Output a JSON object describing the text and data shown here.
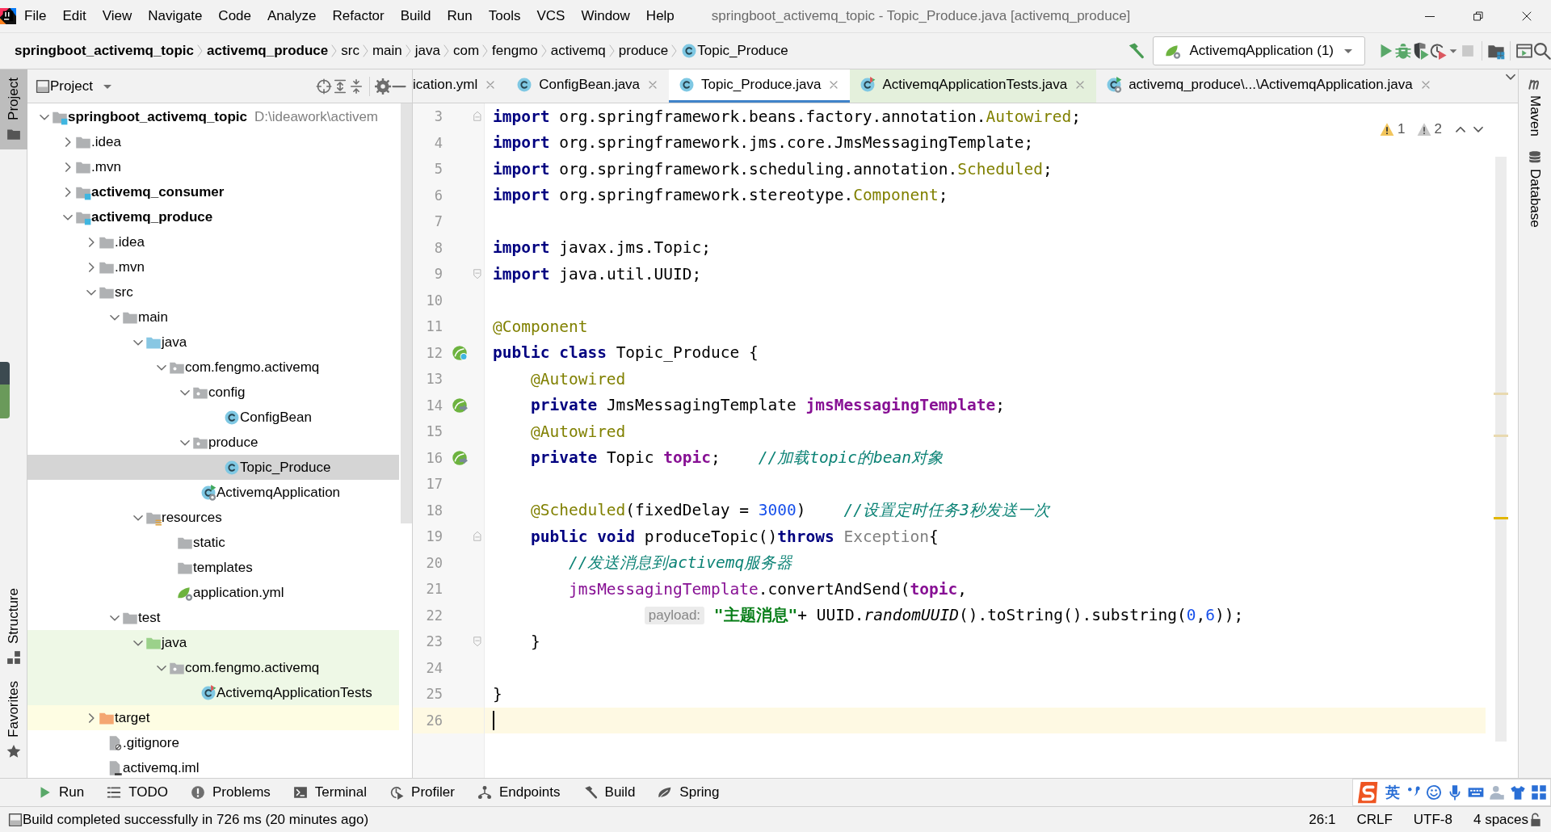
{
  "window": {
    "title": "springboot_activemq_topic - Topic_Produce.java [activemq_produce]"
  },
  "menu": [
    "File",
    "Edit",
    "View",
    "Navigate",
    "Code",
    "Analyze",
    "Refactor",
    "Build",
    "Run",
    "Tools",
    "VCS",
    "Window",
    "Help"
  ],
  "breadcrumbs": [
    {
      "label": "springboot_activemq_topic",
      "kind": "module"
    },
    {
      "label": "activemq_produce",
      "kind": "module"
    },
    {
      "label": "src",
      "kind": "dir"
    },
    {
      "label": "main",
      "kind": "dir"
    },
    {
      "label": "java",
      "kind": "dir"
    },
    {
      "label": "com",
      "kind": "dir"
    },
    {
      "label": "fengmo",
      "kind": "dir"
    },
    {
      "label": "activemq",
      "kind": "dir"
    },
    {
      "label": "produce",
      "kind": "dir"
    },
    {
      "label": "Topic_Produce",
      "kind": "class"
    }
  ],
  "run_config": {
    "label": "ActivemqApplication (1)"
  },
  "left_tool_windows": [
    {
      "label": "Project",
      "selected": true
    },
    {
      "label": "Structure",
      "selected": false
    },
    {
      "label": "Favorites",
      "selected": false
    }
  ],
  "right_tool_windows": [
    {
      "label": "Maven"
    },
    {
      "label": "Database"
    }
  ],
  "project": {
    "title": "Project",
    "tree": [
      {
        "label": "springboot_activemq_topic",
        "path": "D:\\ideawork\\activem",
        "kind": "module",
        "expanded": true,
        "selected": false,
        "children": [
          {
            "label": ".idea",
            "kind": "folder",
            "expanded": false,
            "selected": false
          },
          {
            "label": ".mvn",
            "kind": "folder",
            "expanded": false,
            "selected": false
          },
          {
            "label": "activemq_consumer",
            "kind": "module",
            "expanded": false,
            "selected": false
          },
          {
            "label": "activemq_produce",
            "kind": "module",
            "expanded": true,
            "selected": false,
            "children": [
              {
                "label": ".idea",
                "kind": "folder",
                "expanded": false,
                "selected": false
              },
              {
                "label": ".mvn",
                "kind": "folder",
                "expanded": false,
                "selected": false
              },
              {
                "label": "src",
                "kind": "folder",
                "expanded": true,
                "selected": false,
                "children": [
                  {
                    "label": "main",
                    "kind": "folder",
                    "expanded": true,
                    "selected": false,
                    "children": [
                      {
                        "label": "java",
                        "kind": "source-folder",
                        "expanded": true,
                        "selected": false,
                        "children": [
                          {
                            "label": "com.fengmo.activemq",
                            "kind": "package",
                            "expanded": true,
                            "selected": false,
                            "children": [
                              {
                                "label": "config",
                                "kind": "package",
                                "expanded": true,
                                "selected": false,
                                "children": [
                                  {
                                    "label": "ConfigBean",
                                    "kind": "class",
                                    "selected": false
                                  }
                                ]
                              },
                              {
                                "label": "produce",
                                "kind": "package",
                                "expanded": true,
                                "selected": false,
                                "children": [
                                  {
                                    "label": "Topic_Produce",
                                    "kind": "class",
                                    "selected": true
                                  }
                                ]
                              },
                              {
                                "label": "ActivemqApplication",
                                "kind": "app-class",
                                "selected": false
                              }
                            ]
                          }
                        ]
                      },
                      {
                        "label": "resources",
                        "kind": "resources",
                        "expanded": true,
                        "selected": false,
                        "children": [
                          {
                            "label": "static",
                            "kind": "folder",
                            "selected": false
                          },
                          {
                            "label": "templates",
                            "kind": "folder",
                            "selected": false
                          },
                          {
                            "label": "application.yml",
                            "kind": "yml",
                            "selected": false
                          }
                        ]
                      }
                    ]
                  },
                  {
                    "label": "test",
                    "kind": "folder",
                    "expanded": true,
                    "selected": false,
                    "children": [
                      {
                        "label": "java",
                        "kind": "test-folder",
                        "color": "#eef8e6",
                        "expanded": true,
                        "selected": false,
                        "children": [
                          {
                            "label": "com.fengmo.activemq",
                            "kind": "package",
                            "color": "#eef8e6",
                            "expanded": true,
                            "selected": false,
                            "children": [
                              {
                                "label": "ActivemqApplicationTests",
                                "kind": "test-class",
                                "color": "#eef8e6",
                                "selected": false
                              }
                            ]
                          }
                        ]
                      }
                    ]
                  }
                ]
              },
              {
                "label": "target",
                "kind": "excluded-folder",
                "color": "#fefde3",
                "expanded": false,
                "selected": false
              },
              {
                "label": ".gitignore",
                "kind": "ignore-file",
                "selected": false
              },
              {
                "label": "activemq.iml",
                "kind": "iml-file",
                "selected": false
              }
            ]
          }
        ]
      }
    ]
  },
  "editor_tabs": [
    {
      "label": "ication.yml",
      "kind": "none",
      "selected": false
    },
    {
      "label": "ConfigBean.java",
      "kind": "class",
      "selected": false
    },
    {
      "label": "Topic_Produce.java",
      "kind": "class",
      "selected": true
    },
    {
      "label": "ActivemqApplicationTests.java",
      "kind": "test-class",
      "color": "#e4f0dc",
      "selected": false
    },
    {
      "label": "activemq_produce\\...\\ActivemqApplication.java",
      "kind": "app-class",
      "selected": false
    }
  ],
  "inspections": [
    {
      "kind": "warning",
      "count": "1"
    },
    {
      "kind": "weak-warning",
      "count": "2"
    }
  ],
  "lines": [
    {
      "number": "3",
      "kind": "fold-start",
      "current": false,
      "tokens": [
        {
          "kind": "kw",
          "text": "import"
        },
        {
          "kind": "plain",
          "text": " org.springframework.beans.factory.annotation."
        },
        {
          "kind": "ann",
          "text": "Autowired"
        },
        {
          "kind": "plain",
          "text": ";"
        }
      ]
    },
    {
      "number": "4",
      "kind": "plain",
      "current": false,
      "tokens": [
        {
          "kind": "kw",
          "text": "import"
        },
        {
          "kind": "plain",
          "text": " org.springframework.jms.core.JmsMessagingTemplate;"
        }
      ]
    },
    {
      "number": "5",
      "kind": "plain",
      "current": false,
      "tokens": [
        {
          "kind": "kw",
          "text": "import"
        },
        {
          "kind": "plain",
          "text": " org.springframework.scheduling.annotation."
        },
        {
          "kind": "ann",
          "text": "Scheduled"
        },
        {
          "kind": "plain",
          "text": ";"
        }
      ]
    },
    {
      "number": "6",
      "kind": "plain",
      "current": false,
      "tokens": [
        {
          "kind": "kw",
          "text": "import"
        },
        {
          "kind": "plain",
          "text": " org.springframework.stereotype."
        },
        {
          "kind": "ann",
          "text": "Component"
        },
        {
          "kind": "plain",
          "text": ";"
        }
      ]
    },
    {
      "number": "7",
      "kind": "plain",
      "current": false
    },
    {
      "number": "8",
      "kind": "plain",
      "current": false,
      "tokens": [
        {
          "kind": "kw",
          "text": "import"
        },
        {
          "kind": "plain",
          "text": " javax.jms.Topic;"
        }
      ]
    },
    {
      "number": "9",
      "kind": "fold-end",
      "current": false,
      "tokens": [
        {
          "kind": "kw",
          "text": "import"
        },
        {
          "kind": "plain",
          "text": " java.util.UUID;"
        }
      ]
    },
    {
      "number": "10",
      "kind": "plain",
      "current": false
    },
    {
      "number": "11",
      "kind": "plain",
      "current": false,
      "tokens": [
        {
          "kind": "ann",
          "text": "@Component"
        }
      ]
    },
    {
      "number": "12",
      "kind": "bean",
      "current": false,
      "tokens": [
        {
          "kind": "kw",
          "text": "public class"
        },
        {
          "kind": "plain",
          "text": " Topic_Produce {"
        }
      ]
    },
    {
      "number": "13",
      "kind": "plain",
      "current": false,
      "tokens": [
        {
          "kind": "indent"
        },
        {
          "kind": "ann",
          "text": "@Autowired"
        }
      ]
    },
    {
      "number": "14",
      "kind": "autowired",
      "current": false,
      "tokens": [
        {
          "kind": "indent"
        },
        {
          "kind": "kw",
          "text": "private"
        },
        {
          "kind": "plain",
          "text": " JmsMessagingTemplate "
        },
        {
          "kind": "field",
          "text": "jmsMessagingTemplate"
        },
        {
          "kind": "plain",
          "text": ";"
        }
      ]
    },
    {
      "number": "15",
      "kind": "plain",
      "current": false,
      "tokens": [
        {
          "kind": "indent"
        },
        {
          "kind": "ann",
          "text": "@Autowired"
        }
      ]
    },
    {
      "number": "16",
      "kind": "autowired",
      "current": false,
      "tokens": [
        {
          "kind": "indent"
        },
        {
          "kind": "kw",
          "text": "private"
        },
        {
          "kind": "plain",
          "text": " Topic "
        },
        {
          "kind": "field",
          "text": "topic"
        },
        {
          "kind": "plain",
          "text": ";"
        },
        {
          "kind": "gap"
        },
        {
          "kind": "comment",
          "text": "//加载topic的bean对象"
        }
      ]
    },
    {
      "number": "17",
      "kind": "plain",
      "current": false
    },
    {
      "number": "18",
      "kind": "plain",
      "current": false,
      "tokens": [
        {
          "kind": "indent"
        },
        {
          "kind": "ann",
          "text": "@Scheduled"
        },
        {
          "kind": "plain",
          "text": "(fixedDelay = "
        },
        {
          "kind": "num",
          "text": "3000"
        },
        {
          "kind": "plain",
          "text": ")"
        },
        {
          "kind": "gap"
        },
        {
          "kind": "comment",
          "text": "//设置定时任务3秒发送一次"
        }
      ]
    },
    {
      "number": "19",
      "kind": "fold-start",
      "current": false,
      "tokens": [
        {
          "kind": "indent"
        },
        {
          "kind": "kw",
          "text": "public void"
        },
        {
          "kind": "plain",
          "text": " produceTopic()"
        },
        {
          "kind": "kw",
          "text": "throws"
        },
        {
          "kind": "grey",
          "text": " Exception"
        },
        {
          "kind": "plain",
          "text": "{"
        }
      ]
    },
    {
      "number": "20",
      "kind": "plain",
      "current": false,
      "tokens": [
        {
          "kind": "indent"
        },
        {
          "kind": "indent"
        },
        {
          "kind": "comment",
          "text": "//发送消息到activemq服务器"
        }
      ]
    },
    {
      "number": "21",
      "kind": "plain",
      "current": false,
      "tokens": [
        {
          "kind": "indent"
        },
        {
          "kind": "indent"
        },
        {
          "kind": "field-plain",
          "text": "jmsMessagingTemplate"
        },
        {
          "kind": "plain",
          "text": ".convertAndSend("
        },
        {
          "kind": "field",
          "text": "topic"
        },
        {
          "kind": "plain",
          "text": ","
        }
      ]
    },
    {
      "number": "22",
      "kind": "plain",
      "current": false,
      "tokens": [
        {
          "kind": "indent"
        },
        {
          "kind": "indent"
        },
        {
          "kind": "indent"
        },
        {
          "kind": "indent"
        },
        {
          "kind": "hint",
          "text": "payload:"
        },
        {
          "kind": "space"
        },
        {
          "kind": "str",
          "text": "\"主题消息\""
        },
        {
          "kind": "plain",
          "text": "+ UUID."
        },
        {
          "kind": "static",
          "text": "randomUUID"
        },
        {
          "kind": "plain",
          "text": "().toString().substring("
        },
        {
          "kind": "num",
          "text": "0"
        },
        {
          "kind": "plain",
          "text": ","
        },
        {
          "kind": "num",
          "text": "6"
        },
        {
          "kind": "plain",
          "text": "));"
        }
      ]
    },
    {
      "number": "23",
      "kind": "fold-end",
      "current": false,
      "tokens": [
        {
          "kind": "indent"
        },
        {
          "kind": "plain",
          "text": "}"
        }
      ]
    },
    {
      "number": "24",
      "kind": "plain",
      "current": false
    },
    {
      "number": "25",
      "kind": "plain",
      "current": false,
      "tokens": [
        {
          "kind": "plain",
          "text": "}"
        }
      ]
    },
    {
      "number": "26",
      "kind": "plain",
      "current": true
    }
  ],
  "bottom_tools": [
    {
      "label": "Run",
      "kind": "run"
    },
    {
      "label": "TODO",
      "kind": "todo"
    },
    {
      "label": "Problems",
      "kind": "problems"
    },
    {
      "label": "Terminal",
      "kind": "terminal"
    },
    {
      "label": "Profiler",
      "kind": "profiler"
    },
    {
      "label": "Endpoints",
      "kind": "endpoints"
    },
    {
      "label": "Build",
      "kind": "build"
    },
    {
      "label": "Spring",
      "kind": "spring"
    }
  ],
  "ime": {
    "mode": "英"
  },
  "status_bar": {
    "message": "Build completed successfully in 726 ms (20 minutes ago)",
    "position": "26:1",
    "line_separator": "CRLF",
    "encoding": "UTF-8",
    "indent": "4 spaces"
  }
}
